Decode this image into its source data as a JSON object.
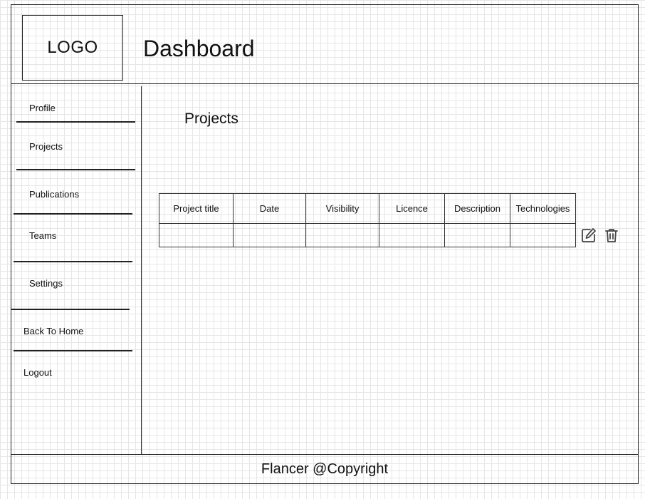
{
  "header": {
    "logo_text": "LOGO",
    "title": "Dashboard"
  },
  "sidebar": {
    "items": [
      {
        "label": "Profile"
      },
      {
        "label": "Projects"
      },
      {
        "label": "Publications"
      },
      {
        "label": "Teams"
      },
      {
        "label": "Settings"
      },
      {
        "label": "Back To Home"
      },
      {
        "label": "Logout"
      }
    ]
  },
  "main": {
    "section_title": "Projects",
    "table": {
      "columns": [
        "Project title",
        "Date",
        "Visibility",
        "Licence",
        "Description",
        "Technologies"
      ],
      "rows": [
        [
          "",
          "",
          "",
          "",
          "",
          ""
        ]
      ]
    },
    "row_actions": [
      "edit-icon",
      "trash-icon"
    ]
  },
  "footer": {
    "text": "Flancer @Copyright"
  }
}
